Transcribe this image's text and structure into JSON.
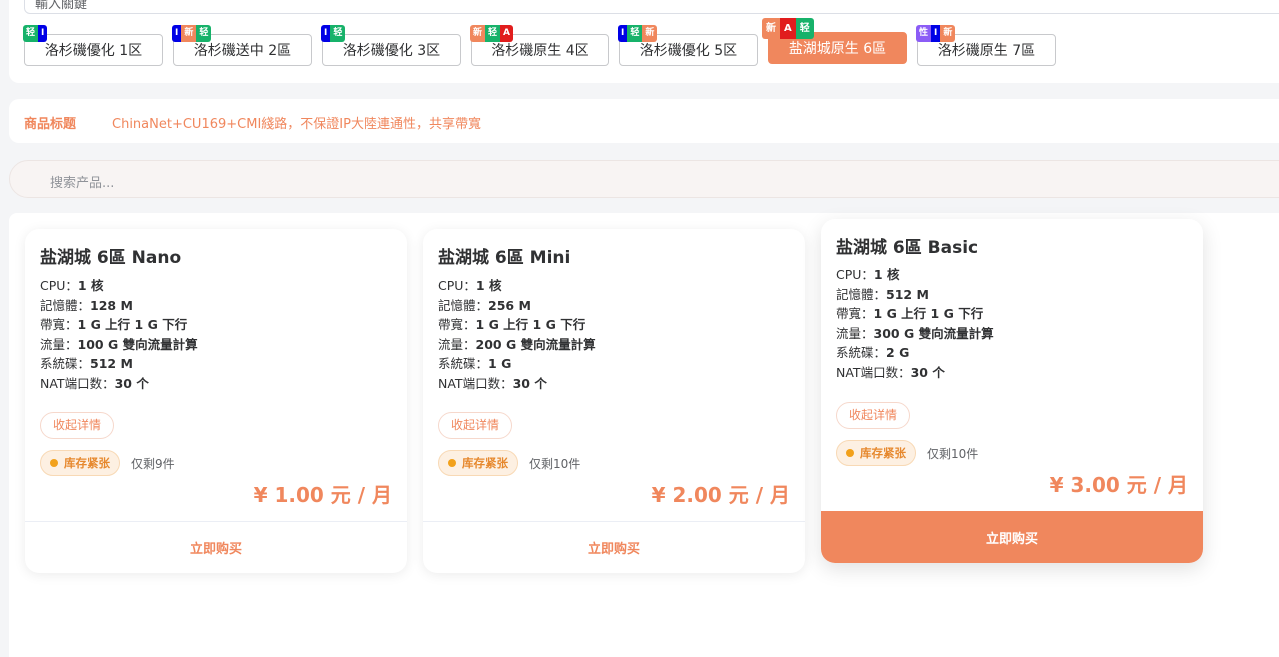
{
  "top_input": {
    "value": "輸入關鍵"
  },
  "regions": [
    {
      "label": "洛杉磯優化 1区",
      "tags": [
        {
          "text": "轻",
          "color": "#17b26a"
        },
        {
          "text": "I",
          "color": "#0000e6"
        }
      ]
    },
    {
      "label": "洛杉磯送中 2區",
      "tags": [
        {
          "text": "I",
          "color": "#0000e6"
        },
        {
          "text": "新",
          "color": "#f0875d"
        },
        {
          "text": "轻",
          "color": "#17b26a"
        }
      ]
    },
    {
      "label": "洛杉磯優化 3区",
      "tags": [
        {
          "text": "I",
          "color": "#0000e6"
        },
        {
          "text": "轻",
          "color": "#17b26a"
        }
      ]
    },
    {
      "label": "洛杉磯原生 4区",
      "tags": [
        {
          "text": "新",
          "color": "#f0875d"
        },
        {
          "text": "轻",
          "color": "#17b26a"
        },
        {
          "text": "A",
          "color": "#e11d1d"
        }
      ]
    },
    {
      "label": "洛杉磯優化 5区",
      "tags": [
        {
          "text": "I",
          "color": "#0000e6"
        },
        {
          "text": "轻",
          "color": "#17b26a"
        },
        {
          "text": "新",
          "color": "#f0875d"
        }
      ]
    },
    {
      "label": "盐湖城原生 6區",
      "active": true,
      "tags": [
        {
          "text": "新",
          "color": "#f0875d"
        },
        {
          "text": "A",
          "color": "#e11d1d"
        },
        {
          "text": "轻",
          "color": "#17b26a"
        }
      ]
    },
    {
      "label": "洛杉磯原生 7區",
      "tags": [
        {
          "text": "性",
          "color": "#8b5cf6"
        },
        {
          "text": "I",
          "color": "#0000e6"
        },
        {
          "text": "新",
          "color": "#f0875d"
        }
      ]
    }
  ],
  "product_title": {
    "label": "商品标题",
    "value": "ChinaNet+CU169+CMI綫路，不保證IP大陸連通性，共享帶寬"
  },
  "search": {
    "placeholder": "搜索产品..."
  },
  "products": [
    {
      "name": "盐湖城 6區 Nano",
      "specs": [
        {
          "key": "CPU：",
          "value": "1 核"
        },
        {
          "key": "記憶體：",
          "value": "128 M"
        },
        {
          "key": "帶寬：",
          "value": "1 G 上行 1 G 下行"
        },
        {
          "key": "流量：",
          "value": "100 G 雙向流量計算"
        },
        {
          "key": "系統碟：",
          "value": "512 M"
        },
        {
          "key": "NAT端口数：",
          "value": "30 个"
        }
      ],
      "collapse_label": "收起详情",
      "stock_label": "库存紧张",
      "remaining": "仅剩9件",
      "price": "¥ 1.00 元 / 月",
      "buy_label": "立即购买"
    },
    {
      "name": "盐湖城 6區 Mini",
      "specs": [
        {
          "key": "CPU：",
          "value": "1 核"
        },
        {
          "key": "記憶體：",
          "value": "256 M"
        },
        {
          "key": "帶寬：",
          "value": "1 G 上行 1 G 下行"
        },
        {
          "key": "流量：",
          "value": "200 G 雙向流量計算"
        },
        {
          "key": "系統碟：",
          "value": "1 G"
        },
        {
          "key": "NAT端口数：",
          "value": "30 个"
        }
      ],
      "collapse_label": "收起详情",
      "stock_label": "库存紧张",
      "remaining": "仅剩10件",
      "price": "¥ 2.00 元 / 月",
      "buy_label": "立即购买"
    },
    {
      "name": "盐湖城 6區 Basic",
      "specs": [
        {
          "key": "CPU：",
          "value": "1 核"
        },
        {
          "key": "記憶體：",
          "value": "512 M"
        },
        {
          "key": "帶寬：",
          "value": "1 G 上行 1 G 下行"
        },
        {
          "key": "流量：",
          "value": "300 G 雙向流量計算"
        },
        {
          "key": "系統碟：",
          "value": "2 G"
        },
        {
          "key": "NAT端口数：",
          "value": "30 个"
        }
      ],
      "collapse_label": "收起详情",
      "stock_label": "库存紧张",
      "remaining": "仅剩10件",
      "price": "¥ 3.00 元 / 月",
      "buy_label": "立即购买"
    }
  ]
}
